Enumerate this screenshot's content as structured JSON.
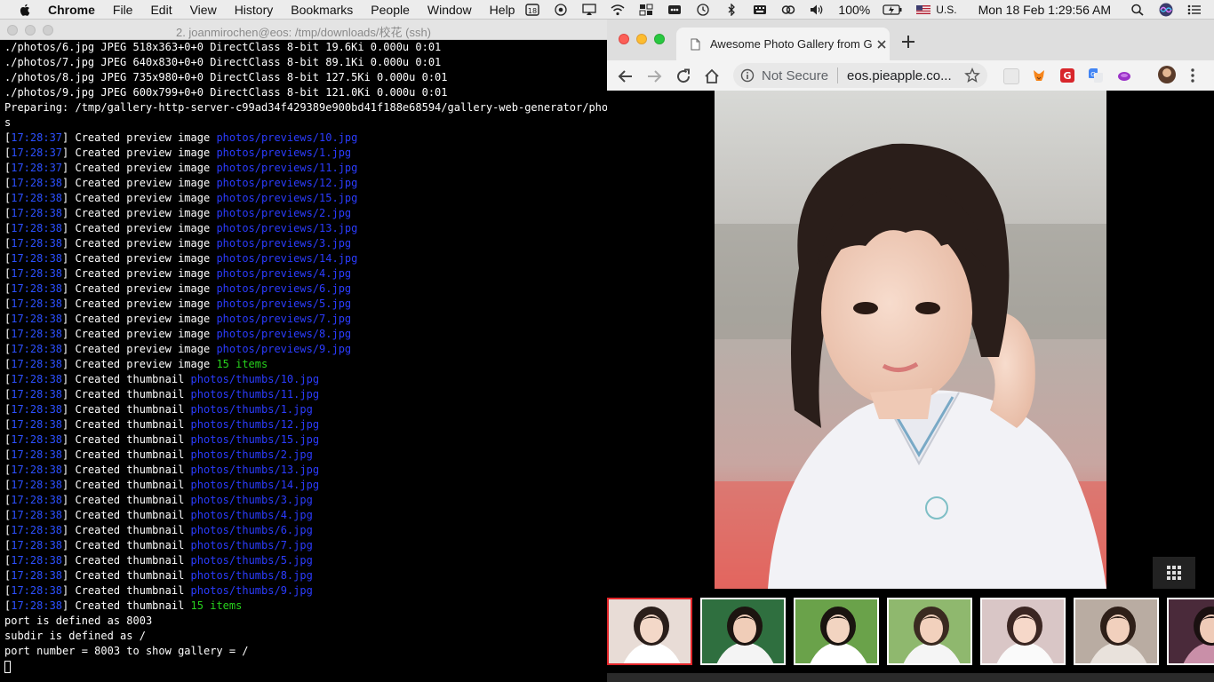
{
  "menubar": {
    "app_name": "Chrome",
    "items": [
      "File",
      "Edit",
      "View",
      "History",
      "Bookmarks",
      "People",
      "Window",
      "Help"
    ],
    "battery": "100%",
    "input_source": "U.S.",
    "clock": "Mon 18 Feb  1:29:56 AM",
    "status_icons": [
      "calendar-icon",
      "chrome-sync-icon",
      "airplay-icon",
      "wifi-icon",
      "window-icon",
      "lastpass-icon",
      "time-machine-icon",
      "bluetooth-icon",
      "keyboard-icon",
      "creative-cloud-icon",
      "volume-icon",
      "battery-icon",
      "flag-icon",
      "spotlight-icon",
      "siri-icon",
      "notification-center-icon"
    ]
  },
  "terminal": {
    "title": "2. joanmirochen@eos: /tmp/downloads/校花 (ssh)",
    "header_lines": [
      "./photos/6.jpg JPEG 518x363+0+0 DirectClass 8-bit 19.6Ki 0.000u 0:01",
      "./photos/7.jpg JPEG 640x830+0+0 DirectClass 8-bit 89.1Ki 0.000u 0:01",
      "./photos/8.jpg JPEG 735x980+0+0 DirectClass 8-bit 127.5Ki 0.000u 0:01",
      "./photos/9.jpg JPEG 600x799+0+0 DirectClass 8-bit 121.0Ki 0.000u 0:01",
      "Preparing: /tmp/gallery-http-server-c99ad34f429389e900bd41f188e68594/gallery-web-generator/photo",
      "s"
    ],
    "log_lines": [
      {
        "ts": "17:28:37",
        "msg": "Created preview image",
        "path": "photos/previews/10.jpg"
      },
      {
        "ts": "17:28:37",
        "msg": "Created preview image",
        "path": "photos/previews/1.jpg"
      },
      {
        "ts": "17:28:37",
        "msg": "Created preview image",
        "path": "photos/previews/11.jpg"
      },
      {
        "ts": "17:28:38",
        "msg": "Created preview image",
        "path": "photos/previews/12.jpg"
      },
      {
        "ts": "17:28:38",
        "msg": "Created preview image",
        "path": "photos/previews/15.jpg"
      },
      {
        "ts": "17:28:38",
        "msg": "Created preview image",
        "path": "photos/previews/2.jpg"
      },
      {
        "ts": "17:28:38",
        "msg": "Created preview image",
        "path": "photos/previews/13.jpg"
      },
      {
        "ts": "17:28:38",
        "msg": "Created preview image",
        "path": "photos/previews/3.jpg"
      },
      {
        "ts": "17:28:38",
        "msg": "Created preview image",
        "path": "photos/previews/14.jpg"
      },
      {
        "ts": "17:28:38",
        "msg": "Created preview image",
        "path": "photos/previews/4.jpg"
      },
      {
        "ts": "17:28:38",
        "msg": "Created preview image",
        "path": "photos/previews/6.jpg"
      },
      {
        "ts": "17:28:38",
        "msg": "Created preview image",
        "path": "photos/previews/5.jpg"
      },
      {
        "ts": "17:28:38",
        "msg": "Created preview image",
        "path": "photos/previews/7.jpg"
      },
      {
        "ts": "17:28:38",
        "msg": "Created preview image",
        "path": "photos/previews/8.jpg"
      },
      {
        "ts": "17:28:38",
        "msg": "Created preview image",
        "path": "photos/previews/9.jpg"
      },
      {
        "ts": "17:28:38",
        "msg": "Created preview image",
        "count": "15 items"
      },
      {
        "ts": "17:28:38",
        "msg": "Created thumbnail",
        "path": "photos/thumbs/10.jpg"
      },
      {
        "ts": "17:28:38",
        "msg": "Created thumbnail",
        "path": "photos/thumbs/11.jpg"
      },
      {
        "ts": "17:28:38",
        "msg": "Created thumbnail",
        "path": "photos/thumbs/1.jpg"
      },
      {
        "ts": "17:28:38",
        "msg": "Created thumbnail",
        "path": "photos/thumbs/12.jpg"
      },
      {
        "ts": "17:28:38",
        "msg": "Created thumbnail",
        "path": "photos/thumbs/15.jpg"
      },
      {
        "ts": "17:28:38",
        "msg": "Created thumbnail",
        "path": "photos/thumbs/2.jpg"
      },
      {
        "ts": "17:28:38",
        "msg": "Created thumbnail",
        "path": "photos/thumbs/13.jpg"
      },
      {
        "ts": "17:28:38",
        "msg": "Created thumbnail",
        "path": "photos/thumbs/14.jpg"
      },
      {
        "ts": "17:28:38",
        "msg": "Created thumbnail",
        "path": "photos/thumbs/3.jpg"
      },
      {
        "ts": "17:28:38",
        "msg": "Created thumbnail",
        "path": "photos/thumbs/4.jpg"
      },
      {
        "ts": "17:28:38",
        "msg": "Created thumbnail",
        "path": "photos/thumbs/6.jpg"
      },
      {
        "ts": "17:28:38",
        "msg": "Created thumbnail",
        "path": "photos/thumbs/7.jpg"
      },
      {
        "ts": "17:28:38",
        "msg": "Created thumbnail",
        "path": "photos/thumbs/5.jpg"
      },
      {
        "ts": "17:28:38",
        "msg": "Created thumbnail",
        "path": "photos/thumbs/8.jpg"
      },
      {
        "ts": "17:28:38",
        "msg": "Created thumbnail",
        "path": "photos/thumbs/9.jpg"
      },
      {
        "ts": "17:28:38",
        "msg": "Created thumbnail",
        "count": "15 items"
      }
    ],
    "footer_lines": [
      "port is defined as 8003",
      "subdir is defined as /",
      "port number = 8003 to show gallery = /"
    ]
  },
  "browser": {
    "tab_title": "Awesome Photo Gallery from G",
    "security_label": "Not Secure",
    "url": "eos.pieapple.co...",
    "colors": {
      "link_blue": "#2b3cff",
      "timestamp_blue": "#2c50ff",
      "success_green": "#27d11d",
      "active_thumb_border": "#e3262a"
    },
    "thumbnails": [
      {
        "active": true,
        "label": "photo-1"
      },
      {
        "active": false,
        "label": "photo-2"
      },
      {
        "active": false,
        "label": "photo-3"
      },
      {
        "active": false,
        "label": "photo-4"
      },
      {
        "active": false,
        "label": "photo-5"
      },
      {
        "active": false,
        "label": "photo-6"
      },
      {
        "active": false,
        "label": "photo-7"
      }
    ]
  }
}
